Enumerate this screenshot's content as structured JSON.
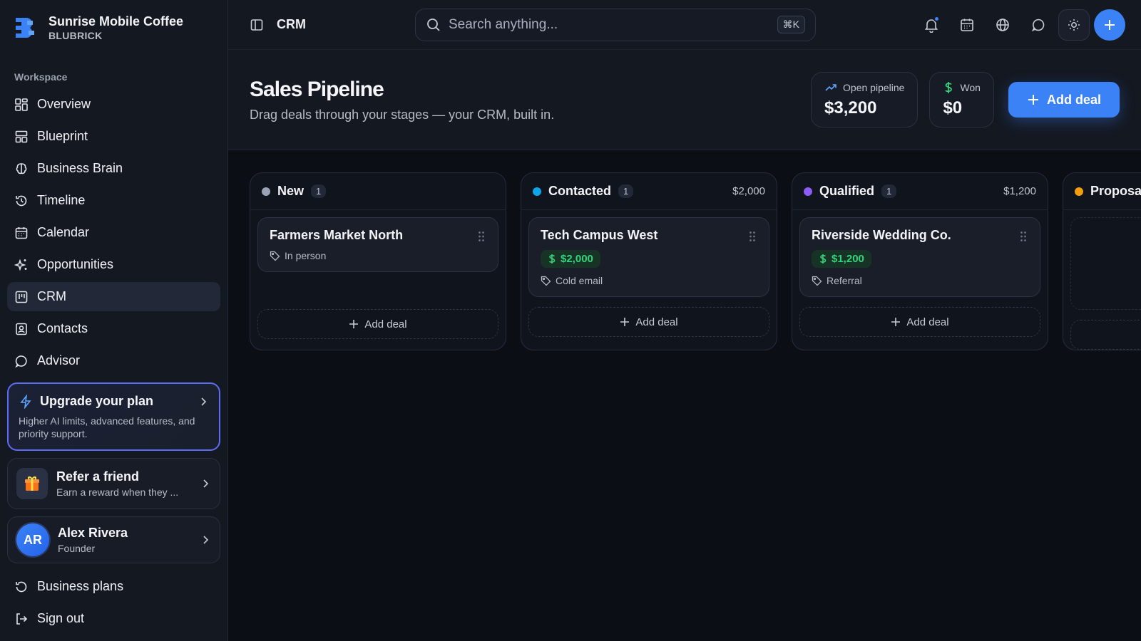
{
  "brand": {
    "name": "Sunrise Mobile Coffee",
    "sub": "BLUBRICK",
    "accent": "#3b82f6"
  },
  "sidebar": {
    "workspace_label": "Workspace",
    "items": [
      {
        "label": "Overview",
        "icon": "grid-icon"
      },
      {
        "label": "Blueprint",
        "icon": "layout-icon"
      },
      {
        "label": "Business Brain",
        "icon": "brain-icon"
      },
      {
        "label": "Timeline",
        "icon": "history-icon"
      },
      {
        "label": "Calendar",
        "icon": "calendar-icon"
      },
      {
        "label": "Opportunities",
        "icon": "sparkles-icon"
      },
      {
        "label": "CRM",
        "icon": "kanban-icon",
        "active": true
      },
      {
        "label": "Contacts",
        "icon": "contact-icon"
      },
      {
        "label": "Advisor",
        "icon": "chat-icon"
      }
    ],
    "upgrade": {
      "title": "Upgrade your plan",
      "desc": "Higher AI limits, advanced features, and priority support."
    },
    "refer": {
      "title": "Refer a friend",
      "sub": "Earn a reward when they ..."
    },
    "user": {
      "initials": "AR",
      "name": "Alex Rivera",
      "role": "Founder"
    },
    "bottom": [
      {
        "label": "Business plans",
        "icon": "history-icon"
      },
      {
        "label": "Sign out",
        "icon": "logout-icon"
      }
    ]
  },
  "topbar": {
    "title": "CRM",
    "search_placeholder": "Search anything...",
    "shortcut": "⌘K"
  },
  "header": {
    "title": "Sales Pipeline",
    "subtitle": "Drag deals through your stages — your CRM, built in.",
    "open_label": "Open pipeline",
    "open_value": "$3,200",
    "won_label": "Won",
    "won_value": "$0",
    "add_deal": "Add deal"
  },
  "board": {
    "add_label": "Add deal",
    "columns": [
      {
        "name": "New",
        "count": "1",
        "total": "",
        "color": "#9aa3b5",
        "deal": {
          "title": "Farmers Market North",
          "amount": "",
          "tag": "In person"
        }
      },
      {
        "name": "Contacted",
        "count": "1",
        "total": "$2,000",
        "color": "#0ea5e9",
        "deal": {
          "title": "Tech Campus West",
          "amount": "$2,000",
          "tag": "Cold email"
        }
      },
      {
        "name": "Qualified",
        "count": "1",
        "total": "$1,200",
        "color": "#8b5cf6",
        "deal": {
          "title": "Riverside Wedding Co.",
          "amount": "$1,200",
          "tag": "Referral"
        }
      },
      {
        "name": "Proposal",
        "count": "",
        "total": "",
        "color": "#f59e0b"
      }
    ]
  }
}
